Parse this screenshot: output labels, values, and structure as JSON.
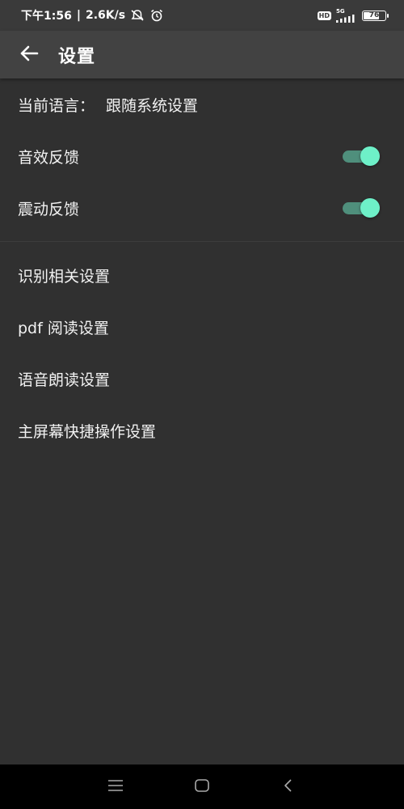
{
  "status_bar": {
    "time": "下午1:56",
    "separator": "|",
    "net_speed": "2.6K/s",
    "hd_label": "HD",
    "network_label": "5G",
    "battery_level": "76",
    "battery_fraction": 0.76,
    "icons": [
      "mute-icon",
      "alarm-icon",
      "hd-icon",
      "signal-icon",
      "battery-icon"
    ]
  },
  "app_bar": {
    "title": "设置",
    "back_icon": "arrow-left-icon"
  },
  "settings": {
    "language_label": "当前语言：",
    "language_value": "跟随系统设置",
    "sound_feedback": {
      "label": "音效反馈",
      "enabled": true
    },
    "vibration_feedback": {
      "label": "震动反馈",
      "enabled": true
    },
    "items": [
      {
        "label": "识别相关设置"
      },
      {
        "label": "pdf 阅读设置"
      },
      {
        "label": "语音朗读设置"
      },
      {
        "label": "主屏幕快捷操作设置"
      }
    ]
  },
  "colors": {
    "background": "#303030",
    "app_bar": "#424242",
    "toggle_thumb": "#6ef0c8",
    "toggle_track": "#4f8f7c"
  },
  "nav_bar": {
    "icons": [
      "menu-icon",
      "home-square-icon",
      "back-chevron-icon"
    ]
  }
}
